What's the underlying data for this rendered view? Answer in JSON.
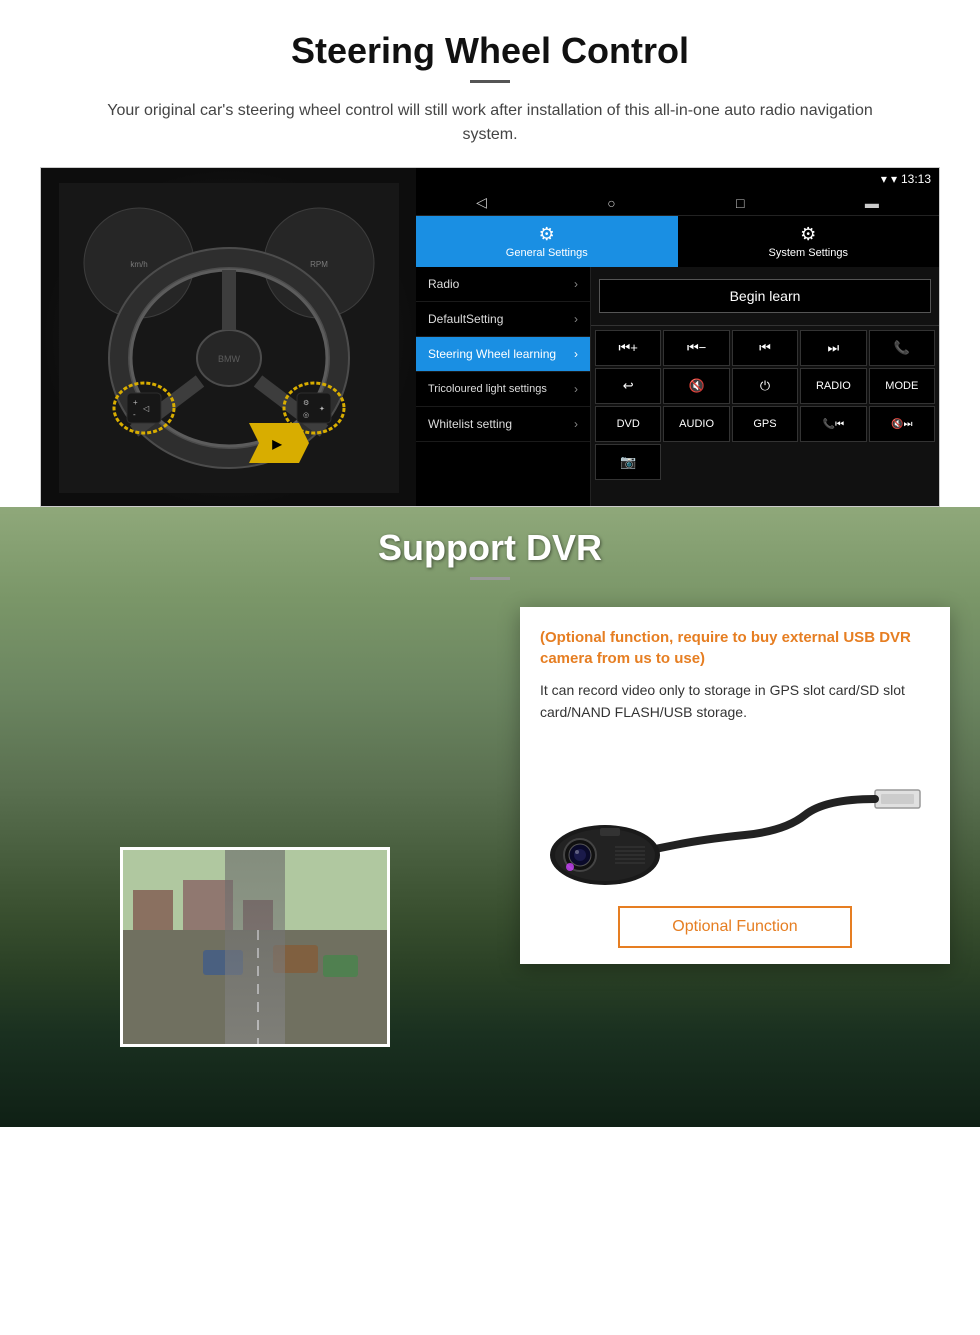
{
  "steering": {
    "title": "Steering Wheel Control",
    "subtitle": "Your original car's steering wheel control will still work after installation of this all-in-one auto radio navigation system.",
    "status_time": "13:13",
    "tabs": [
      {
        "icon": "⚙",
        "label": "General Settings",
        "active": true
      },
      {
        "icon": "⚙",
        "label": "System Settings",
        "active": false
      }
    ],
    "menu_items": [
      {
        "label": "Radio",
        "active": false
      },
      {
        "label": "DefaultSetting",
        "active": false
      },
      {
        "label": "Steering Wheel learning",
        "active": true
      },
      {
        "label": "Tricoloured light settings",
        "active": false
      },
      {
        "label": "Whitelist setting",
        "active": false
      }
    ],
    "begin_learn": "Begin learn",
    "control_buttons_row1": [
      "⏮+",
      "⏮-",
      "⏮⏮",
      "⏭⏭",
      "📞"
    ],
    "control_buttons_row2": [
      "↩",
      "🔇",
      "⏻",
      "RADIO",
      "MODE"
    ],
    "control_buttons_row3": [
      "DVD",
      "AUDIO",
      "GPS",
      "📞⏮",
      "🔇⏭"
    ],
    "control_buttons_row4": [
      "📷"
    ]
  },
  "dvr": {
    "title": "Support DVR",
    "card_orange_text": "(Optional function, require to buy external USB DVR camera from us to use)",
    "card_body_text": "It can record video only to storage in GPS slot card/SD slot card/NAND FLASH/USB storage.",
    "optional_function_label": "Optional Function"
  }
}
